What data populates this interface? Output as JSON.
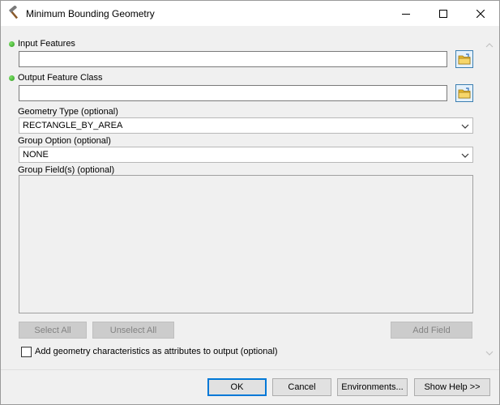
{
  "window": {
    "title": "Minimum Bounding Geometry"
  },
  "params": {
    "input_features": {
      "label": "Input Features",
      "value": ""
    },
    "output_feature_class": {
      "label": "Output Feature Class",
      "value": ""
    },
    "geometry_type": {
      "label": "Geometry Type (optional)",
      "value": "RECTANGLE_BY_AREA"
    },
    "group_option": {
      "label": "Group Option (optional)",
      "value": "NONE"
    },
    "group_fields": {
      "label": "Group Field(s) (optional)"
    },
    "add_geometry": {
      "label": "Add geometry characteristics as attributes to output (optional)",
      "checked": false
    }
  },
  "field_buttons": {
    "select_all": "Select All",
    "unselect_all": "Unselect All",
    "add_field": "Add Field"
  },
  "footer": {
    "ok": "OK",
    "cancel": "Cancel",
    "environments": "Environments...",
    "show_help": "Show Help >>"
  },
  "icons": {
    "app": "hammer-icon",
    "browse": "folder-icon",
    "required": "green-dot-icon"
  },
  "colors": {
    "required_dot": "#2e9a1f",
    "folder": "#e8b92f",
    "primary_border": "#0078d7"
  }
}
